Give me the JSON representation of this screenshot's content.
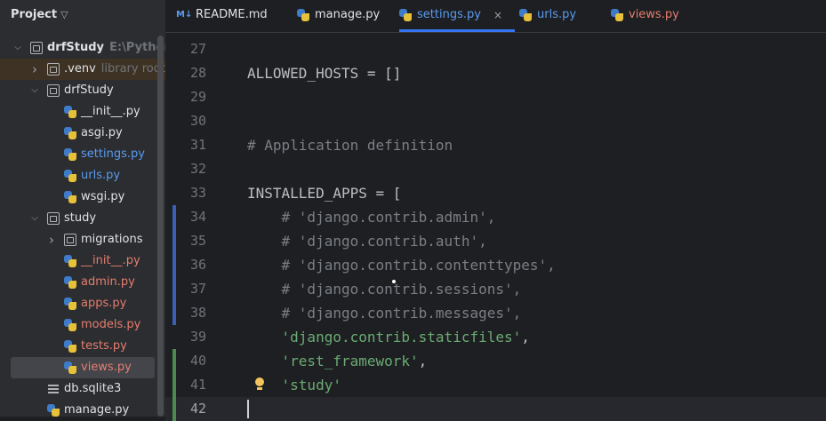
{
  "sidebar": {
    "title": "Project",
    "tree": [
      {
        "label": "drfStudy",
        "hint": "E:\\PythonProj",
        "type": "folder",
        "depth": 0,
        "expanded": true,
        "bold": true,
        "color": "#dfe1e5"
      },
      {
        "label": ".venv",
        "hint": "library root",
        "type": "folder",
        "depth": 1,
        "expanded": false,
        "color": "#dfe1e5"
      },
      {
        "label": "drfStudy",
        "type": "folder",
        "depth": 1,
        "expanded": true,
        "color": "#dfe1e5"
      },
      {
        "label": "__init__.py",
        "type": "py",
        "depth": 2,
        "color": "#dfe1e5"
      },
      {
        "label": "asgi.py",
        "type": "py",
        "depth": 2,
        "color": "#dfe1e5"
      },
      {
        "label": "settings.py",
        "type": "py",
        "depth": 2,
        "color": "#5a9bf0"
      },
      {
        "label": "urls.py",
        "type": "py",
        "depth": 2,
        "color": "#5a9bf0"
      },
      {
        "label": "wsgi.py",
        "type": "py",
        "depth": 2,
        "color": "#dfe1e5"
      },
      {
        "label": "study",
        "type": "folder",
        "depth": 1,
        "expanded": true,
        "color": "#dfe1e5"
      },
      {
        "label": "migrations",
        "type": "folder",
        "depth": 2,
        "expanded": false,
        "color": "#dfe1e5"
      },
      {
        "label": "__init__.py",
        "type": "py",
        "depth": 2,
        "color": "#e57d6f"
      },
      {
        "label": "admin.py",
        "type": "py",
        "depth": 2,
        "color": "#e57d6f"
      },
      {
        "label": "apps.py",
        "type": "py",
        "depth": 2,
        "color": "#e57d6f"
      },
      {
        "label": "models.py",
        "type": "py",
        "depth": 2,
        "color": "#e57d6f"
      },
      {
        "label": "tests.py",
        "type": "py",
        "depth": 2,
        "color": "#e57d6f"
      },
      {
        "label": "views.py",
        "type": "py",
        "depth": 2,
        "color": "#e57d6f",
        "selected": true
      },
      {
        "label": "db.sqlite3",
        "type": "db",
        "depth": 1,
        "color": "#dfe1e5"
      },
      {
        "label": "manage.py",
        "type": "py",
        "depth": 1,
        "color": "#dfe1e5"
      }
    ]
  },
  "tabs": [
    {
      "label": "README.md",
      "icon": "markdown-icon",
      "icon_text": "M↓",
      "color": "#dfe1e5"
    },
    {
      "label": "manage.py",
      "icon": "python-file-icon",
      "color": "#dfe1e5"
    },
    {
      "label": "settings.py",
      "icon": "python-file-icon",
      "color": "#5a9bf0",
      "active": true,
      "close": "×"
    },
    {
      "label": "urls.py",
      "icon": "python-file-icon",
      "color": "#5a9bf0"
    },
    {
      "label": "views.py",
      "icon": "python-file-icon",
      "color": "#e57d6f"
    }
  ],
  "editor": {
    "lines": [
      {
        "n": "27",
        "text": "",
        "kind": "def"
      },
      {
        "n": "28",
        "text": "ALLOWED_HOSTS = []",
        "kind": "def"
      },
      {
        "n": "29",
        "text": "",
        "kind": "def"
      },
      {
        "n": "30",
        "text": "",
        "kind": "def"
      },
      {
        "n": "31",
        "text": "# Application definition",
        "kind": "com"
      },
      {
        "n": "32",
        "text": "",
        "kind": "def"
      },
      {
        "n": "33",
        "text": "INSTALLED_APPS = [",
        "kind": "def"
      },
      {
        "n": "34",
        "text": "    # 'django.contrib.admin',",
        "kind": "com",
        "change": "modified"
      },
      {
        "n": "35",
        "text": "    # 'django.contrib.auth',",
        "kind": "com",
        "change": "modified"
      },
      {
        "n": "36",
        "text": "    # 'django.contrib.contenttypes',",
        "kind": "com",
        "change": "modified"
      },
      {
        "n": "37",
        "text": "    # 'django.contrib.sessions',",
        "kind": "com",
        "change": "modified"
      },
      {
        "n": "38",
        "text": "    # 'django.contrib.messages',",
        "kind": "com",
        "change": "modified"
      },
      {
        "n": "39",
        "text": "    'django.contrib.staticfiles',",
        "kind": "str",
        "trail": ","
      },
      {
        "n": "40",
        "text": "    'rest_framework',",
        "kind": "str",
        "trail": ",",
        "change": "added"
      },
      {
        "n": "41",
        "text": "    'study'",
        "kind": "str",
        "change": "added",
        "bulb": true
      },
      {
        "n": "42",
        "text": "",
        "kind": "def",
        "change": "added",
        "current": true
      }
    ]
  },
  "colors": {
    "modified": "#3b5fb5",
    "added": "#4e8a4f",
    "accent": "#3574f0"
  }
}
